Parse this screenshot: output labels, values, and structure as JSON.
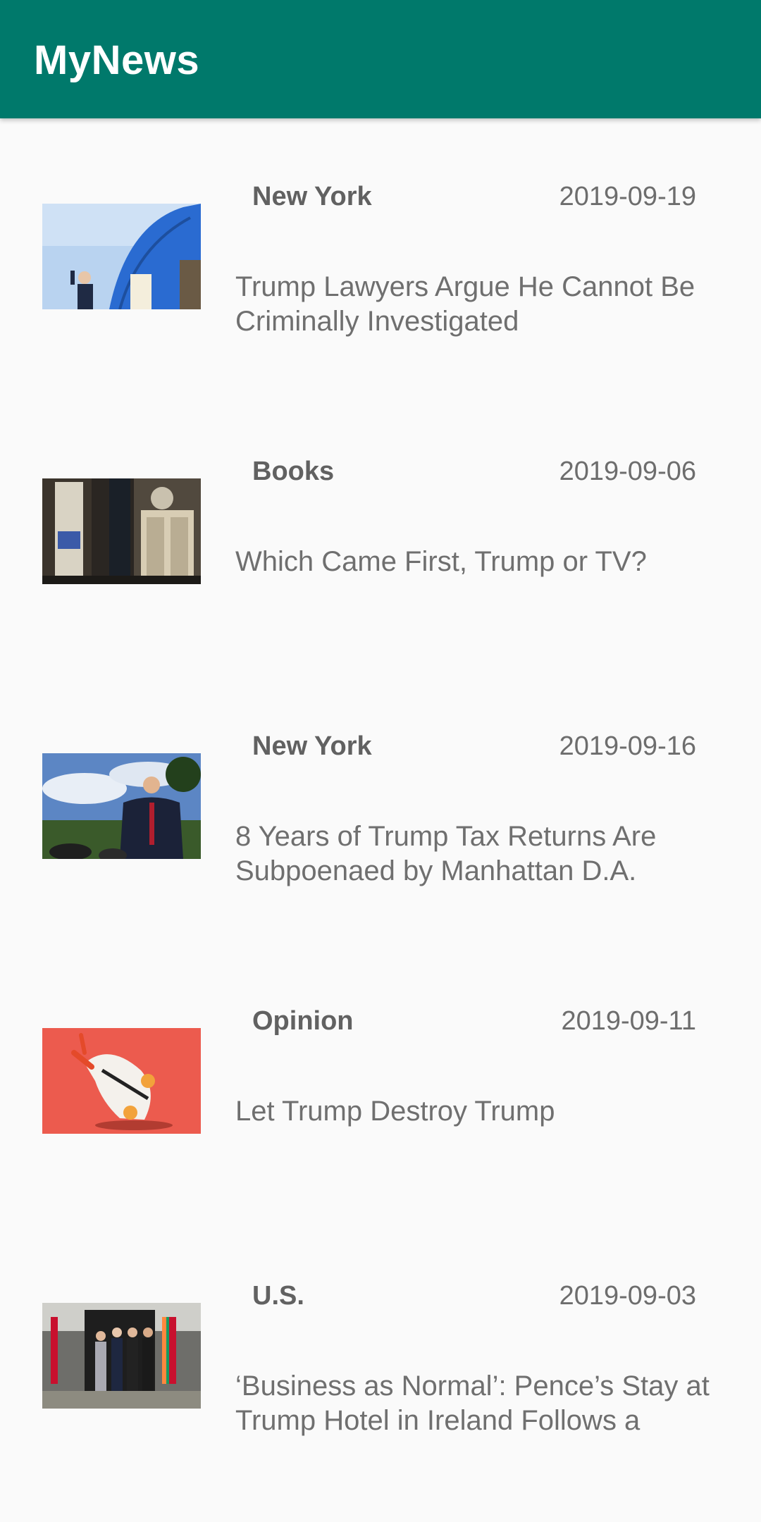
{
  "app": {
    "title": "MyNews"
  },
  "articles": [
    {
      "section": "New York",
      "date": "2019-09-19",
      "headline": "Trump Lawyers Argue He Cannot Be Criminally Investigated"
    },
    {
      "section": "Books",
      "date": "2019-09-06",
      "headline": "Which Came First, Trump or TV?"
    },
    {
      "section": "New York",
      "date": "2019-09-16",
      "headline": "8 Years of Trump Tax Returns Are Subpoenaed by Manhattan D.A."
    },
    {
      "section": "Opinion",
      "date": "2019-09-11",
      "headline": "Let Trump Destroy Trump"
    },
    {
      "section": "U.S.",
      "date": "2019-09-03",
      "headline": "‘Business as Normal’: Pence’s Stay at Trump Hotel in Ireland Follows a"
    }
  ],
  "colors": {
    "appbar": "#00796b",
    "background": "#fafafa",
    "text": "#6f6f6f"
  }
}
